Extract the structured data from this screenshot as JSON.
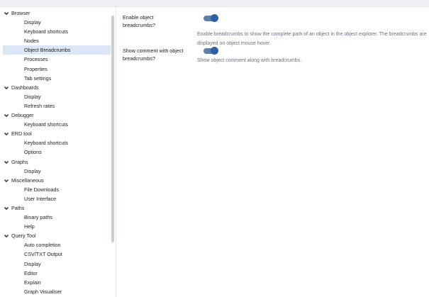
{
  "sidebar": {
    "items": [
      {
        "label": "Browser",
        "type": "group"
      },
      {
        "label": "Display",
        "type": "child"
      },
      {
        "label": "Keyboard shortcuts",
        "type": "child"
      },
      {
        "label": "Nodes",
        "type": "child"
      },
      {
        "label": "Object Breadcrumbs",
        "type": "child",
        "selected": true
      },
      {
        "label": "Processes",
        "type": "child"
      },
      {
        "label": "Properties",
        "type": "child"
      },
      {
        "label": "Tab settings",
        "type": "child"
      },
      {
        "label": "Dashboards",
        "type": "group"
      },
      {
        "label": "Display",
        "type": "child"
      },
      {
        "label": "Refresh rates",
        "type": "child"
      },
      {
        "label": "Debugger",
        "type": "group"
      },
      {
        "label": "Keyboard shortcuts",
        "type": "child"
      },
      {
        "label": "ERD tool",
        "type": "group"
      },
      {
        "label": "Keyboard shortcuts",
        "type": "child"
      },
      {
        "label": "Options",
        "type": "child"
      },
      {
        "label": "Graphs",
        "type": "group"
      },
      {
        "label": "Display",
        "type": "child"
      },
      {
        "label": "Miscellaneous",
        "type": "group"
      },
      {
        "label": "File Downloads",
        "type": "child"
      },
      {
        "label": "User Interface",
        "type": "child"
      },
      {
        "label": "Paths",
        "type": "group"
      },
      {
        "label": "Binary paths",
        "type": "child"
      },
      {
        "label": "Help",
        "type": "child"
      },
      {
        "label": "Query Tool",
        "type": "group"
      },
      {
        "label": "Auto completion",
        "type": "child"
      },
      {
        "label": "CSV/TXT Output",
        "type": "child"
      },
      {
        "label": "Display",
        "type": "child"
      },
      {
        "label": "Editor",
        "type": "child"
      },
      {
        "label": "Explain",
        "type": "child"
      },
      {
        "label": "Graph Visualiser",
        "type": "child"
      }
    ]
  },
  "settings": {
    "enable_breadcrumbs": {
      "label": "Enable object breadcrumbs?",
      "enabled": true,
      "help": "Enable breadcrumbs to show the complete path of an object in the object explorer. The breadcrumbs are displayed on object mouse hover."
    },
    "show_comment": {
      "label": "Show comment with object breadcrumbs?",
      "enabled": true,
      "help": "Show object comment along with breadcrumbs."
    }
  },
  "colors": {
    "toggle_track": "#5e7fa9",
    "toggle_knob": "#2f5fa5",
    "selected_bg": "#dbe6f6"
  }
}
